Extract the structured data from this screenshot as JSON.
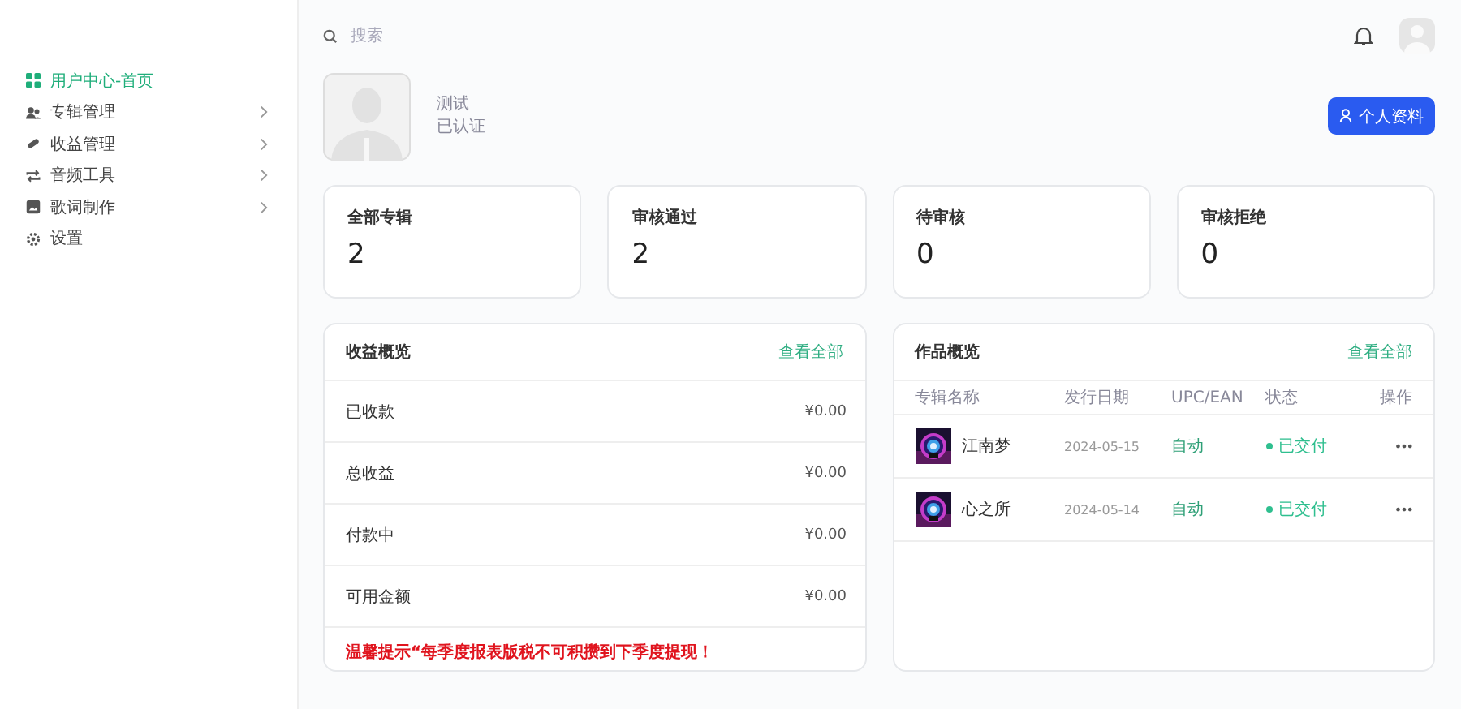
{
  "sidebar": {
    "items": [
      {
        "label": "用户中心-首页",
        "selected": true,
        "expandable": false
      },
      {
        "label": "专辑管理",
        "selected": false,
        "expandable": true
      },
      {
        "label": "收益管理",
        "selected": false,
        "expandable": true
      },
      {
        "label": "音频工具",
        "selected": false,
        "expandable": true
      },
      {
        "label": "歌词制作",
        "selected": false,
        "expandable": true
      },
      {
        "label": "设置",
        "selected": false,
        "expandable": false
      }
    ]
  },
  "search": {
    "placeholder": "搜索"
  },
  "profile": {
    "name": "测试",
    "status": "已认证",
    "button": "个人资料"
  },
  "stats": [
    {
      "label": "全部专辑",
      "value": "2"
    },
    {
      "label": "审核通过",
      "value": "2"
    },
    {
      "label": "待审核",
      "value": "0"
    },
    {
      "label": "审核拒绝",
      "value": "0"
    }
  ],
  "income": {
    "title": "收益概览",
    "link": "查看全部",
    "rows": [
      {
        "label": "已收款",
        "amount": "¥0.00"
      },
      {
        "label": "总收益",
        "amount": "¥0.00"
      },
      {
        "label": "付款中",
        "amount": "¥0.00"
      },
      {
        "label": "可用金额",
        "amount": "¥0.00"
      }
    ],
    "notice": "温馨提示“每季度报表版税不可积攒到下季度提现！"
  },
  "works": {
    "title": "作品概览",
    "link": "查看全部",
    "columns": [
      "专辑名称",
      "发行日期",
      "UPC/EAN",
      "状态",
      "操作"
    ],
    "rows": [
      {
        "name": "江南梦",
        "date": "2024-05-15",
        "upc": "自动",
        "status": "已交付",
        "action": "•••"
      },
      {
        "name": "心之所",
        "date": "2024-05-14",
        "upc": "自动",
        "status": "已交付",
        "action": "•••"
      }
    ]
  }
}
